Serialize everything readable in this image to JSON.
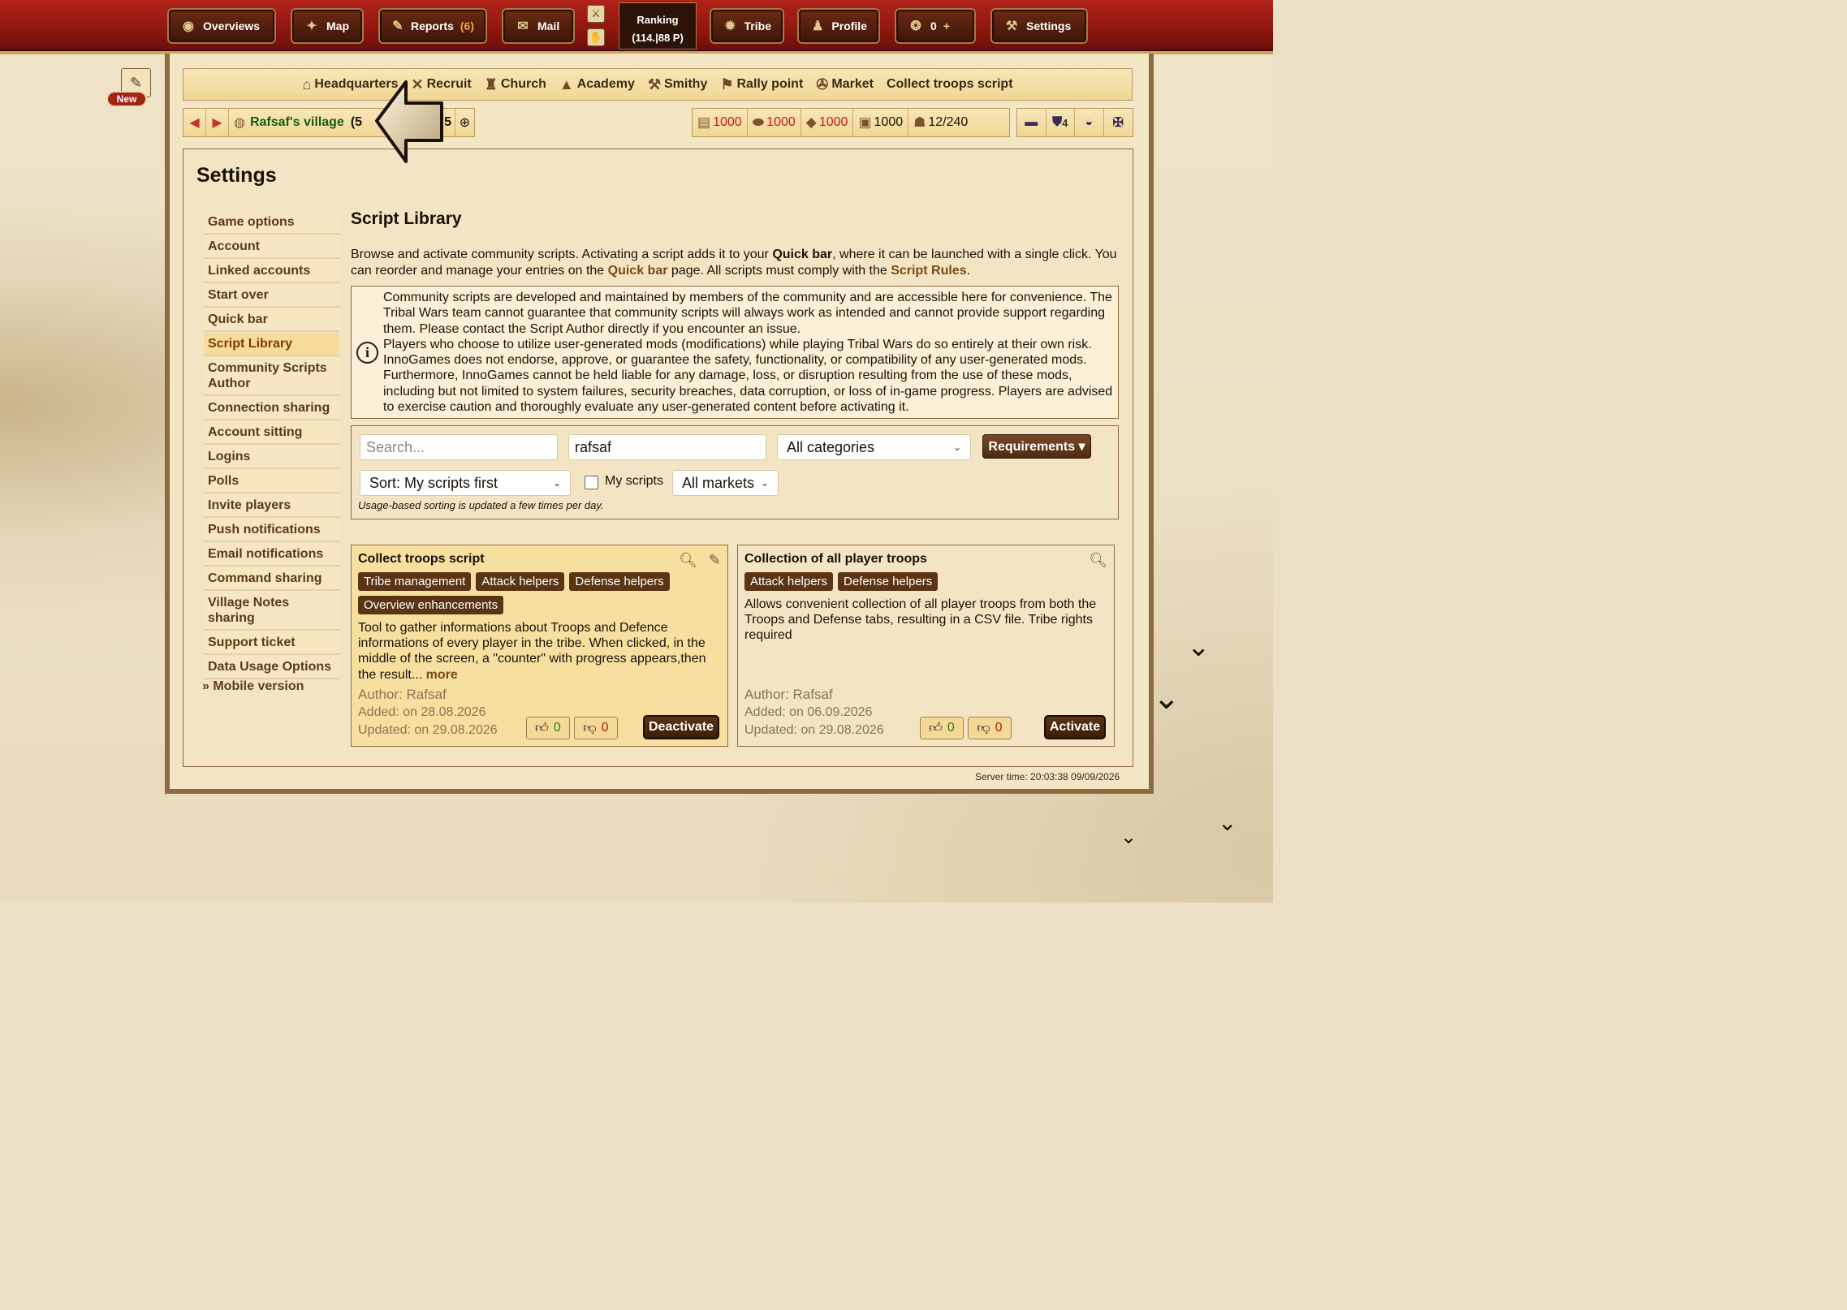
{
  "nav": {
    "overviews": "Overviews",
    "map": "Map",
    "reports": "Reports",
    "reports_count": "(6)",
    "mail": "Mail",
    "ranking_label": "Ranking",
    "ranking_value": "(114.|88 P)",
    "tribe": "Tribe",
    "profile": "Profile",
    "premium_count": "0",
    "premium_plus": "+",
    "settings": "Settings"
  },
  "new_badge": "New",
  "buildings": [
    "Headquarters",
    "Recruit",
    "Church",
    "Academy",
    "Smithy",
    "Rally point",
    "Market",
    "Collect troops script"
  ],
  "village": {
    "name": "Rafsaf's village",
    "coords_left": "(5",
    "coords_right": "5"
  },
  "resources": {
    "wood": "1000",
    "clay": "1000",
    "iron": "1000",
    "storage": "1000",
    "population": "12/240"
  },
  "iconbar": {
    "badge": "4"
  },
  "page": {
    "title": "Settings"
  },
  "menu": [
    "Game options",
    "Account",
    "Linked accounts",
    "Start over",
    "Quick bar",
    "Script Library",
    "Community Scripts Author",
    "Connection sharing",
    "Account sitting",
    "Logins",
    "Polls",
    "Invite players",
    "Push notifications",
    "Email notifications",
    "Command sharing",
    "Village Notes sharing",
    "Support ticket",
    "Data Usage Options"
  ],
  "menu_selected": "Script Library",
  "mobile_link": "» Mobile version",
  "library": {
    "title": "Script Library",
    "intro_1": "Browse and activate community scripts. Activating a script adds it to your ",
    "intro_quickbar": "Quick bar",
    "intro_2": ", where it can be launched with a single click. You can reorder and manage your entries on the ",
    "intro_quickbar_link": "Quick bar",
    "intro_3": " page. All scripts must comply with the ",
    "intro_rules": "Script Rules",
    "intro_4": ".",
    "info_1": "Community scripts are developed and maintained by members of the community and are accessible here for convenience. The Tribal Wars team cannot guarantee that community scripts will always work as intended and cannot provide support regarding them. Please contact the Script Author directly if you encounter an issue.",
    "info_2": "Players who choose to utilize user-generated mods (modifications) while playing Tribal Wars do so entirely at their own risk. InnoGames does not endorse, approve, or guarantee the safety, functionality, or compatibility of any user-generated mods. Furthermore, InnoGames cannot be held liable for any damage, loss, or disruption resulting from the use of these mods, including but not limited to system failures, security breaches, data corruption, or loss of in-game progress. Players are advised to exercise caution and thoroughly evaluate any user-generated content before activating it."
  },
  "filters": {
    "search_placeholder": "Search...",
    "author_value": "rafsaf",
    "category": "All categories",
    "requirements": "Requirements ▾",
    "sort": "Sort: My scripts first",
    "my_scripts": "My scripts",
    "markets": "All markets",
    "note": "Usage-based sorting is updated a few times per day."
  },
  "scripts": [
    {
      "title": "Collect troops script",
      "tags": [
        "Tribe management",
        "Attack helpers",
        "Defense helpers",
        "Overview enhancements"
      ],
      "description": "Tool to gather informations about Troops and Defence informations of every player in the tribe. When clicked, in the middle of the screen, a \"counter\" with progress appears,then the result...",
      "more": "more",
      "author": "Author: Rafsaf",
      "added": "Added: on 28.08.2026",
      "updated": "Updated: on 29.08.2026",
      "up": "0",
      "down": "0",
      "action": "Deactivate"
    },
    {
      "title": "Collection of all player troops",
      "tags": [
        "Attack helpers",
        "Defense helpers"
      ],
      "description": "Allows convenient collection of all player troops from both the Troops and Defense tabs, resulting in a CSV file. Tribe rights required",
      "author": "Author: Rafsaf",
      "added": "Added: on 06.09.2026",
      "updated": "Updated: on 29.08.2026",
      "up": "0",
      "down": "0",
      "action": "Activate"
    }
  ],
  "server_time": "Server time: 20:03:38 09/09/2026"
}
